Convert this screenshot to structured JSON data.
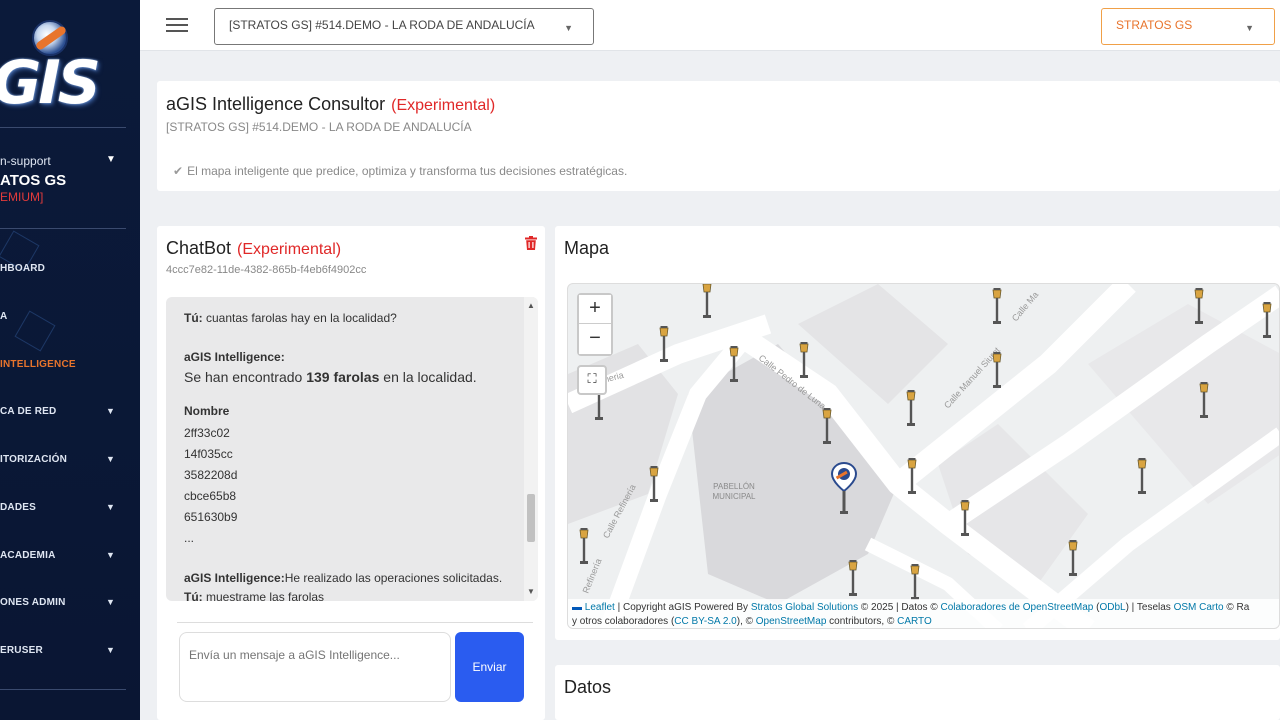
{
  "topbar": {
    "project": "[STRATOS GS] #514.DEMO - LA RODA DE ANDALUCÍA",
    "org": "STRATOS GS"
  },
  "sidebar": {
    "role": "n-support",
    "user": "ATOS GS",
    "plan": "EMIUM]",
    "items": [
      {
        "label": "HBOARD",
        "caret": false,
        "active": false
      },
      {
        "label": "A",
        "caret": false,
        "active": false
      },
      {
        "label": "INTELLIGENCE",
        "caret": false,
        "active": true
      },
      {
        "label": "CA DE RED",
        "caret": true,
        "active": false
      },
      {
        "label": "ITORIZACIÓN",
        "caret": true,
        "active": false
      },
      {
        "label": "DADES",
        "caret": true,
        "active": false
      },
      {
        "label": "ACADEMIA",
        "caret": true,
        "active": false
      },
      {
        "label": "ONES ADMIN",
        "caret": true,
        "active": false
      },
      {
        "label": "ERUSER",
        "caret": true,
        "active": false
      }
    ]
  },
  "header": {
    "title": "aGIS Intelligence Consultor",
    "tag": "(Experimental)",
    "subtitle": "[STRATOS GS] #514.DEMO - LA RODA DE ANDALUCÍA",
    "description": "El mapa inteligente que predice, optimiza y transforma tus decisiones estratégicas."
  },
  "chat": {
    "title": "ChatBot",
    "tag": "(Experimental)",
    "session_id": "4ccc7e82-11de-4382-865b-f4eb6f4902cc",
    "user_label": "Tú:",
    "q1": "cuantas farolas hay en la localidad?",
    "bot_label": "aGIS Intelligence:",
    "a1_pre": "Se han encontrado ",
    "a1_bold": "139 farolas",
    "a1_post": " en la localidad.",
    "col_header": "Nombre",
    "names": [
      "2ff33c02",
      "14f035cc",
      "3582208d",
      "cbce65b8",
      "651630b9"
    ],
    "ellipsis": "...",
    "bot_label2": "aGIS Intelligence:",
    "a2": "He realizado las operaciones solicitadas.",
    "user_label2": "Tú:",
    "q2": "muestrame las farolas",
    "input_placeholder": "Envía un mensaje a aGIS Intelligence...",
    "send_label": "Enviar"
  },
  "map": {
    "title": "Mapa",
    "zoom_in": "+",
    "zoom_out": "−",
    "streets": {
      "s1": "Calle Pedro de Luna",
      "s2": "Calle Manuel Siurot",
      "s3": "Calle Refinería",
      "s4": "Refinería",
      "s5": "oneria",
      "s6": "Calle Ma"
    },
    "building": [
      "PABELLÓN",
      "MUNICIPAL"
    ],
    "attribution": {
      "leaflet": "Leaflet",
      "t1": " | Copyright aGIS Powered By ",
      "stratos": "Stratos Global Solutions",
      "t2": " © 2025 | Datos © ",
      "osm_contrib": "Colaboradores de OpenStreetMap",
      "t3": " (",
      "odbl": "ODbL",
      "t4": ") | Teselas ",
      "osm_carto": "OSM Carto",
      "t5": " © Ra",
      "t6": "y otros colaboradores (",
      "ccbysa": "CC BY-SA 2.0",
      "t7": "), © ",
      "osm": "OpenStreetMap",
      "t8": " contributors, © ",
      "carto": "CARTO"
    }
  },
  "data": {
    "title": "Datos"
  }
}
